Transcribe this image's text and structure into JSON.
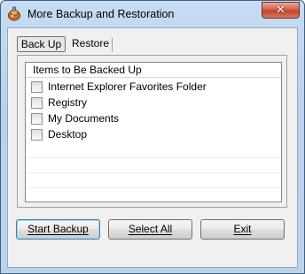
{
  "window": {
    "title": "More Backup and Restoration",
    "close_glyph": "✕"
  },
  "tabs": [
    {
      "label": "Back Up",
      "selected": true
    },
    {
      "label": "Restore",
      "selected": false
    }
  ],
  "list": {
    "header": "Items to Be Backed Up",
    "items": [
      {
        "label": "Internet Explorer Favorites Folder",
        "checked": false
      },
      {
        "label": "Registry",
        "checked": false
      },
      {
        "label": "My Documents",
        "checked": false
      },
      {
        "label": "Desktop",
        "checked": false
      }
    ]
  },
  "buttons": {
    "start_backup": "Start Backup",
    "select_all": "Select All",
    "exit": "Exit"
  },
  "icons": {
    "app": "backup-app-icon",
    "close": "close-icon"
  }
}
